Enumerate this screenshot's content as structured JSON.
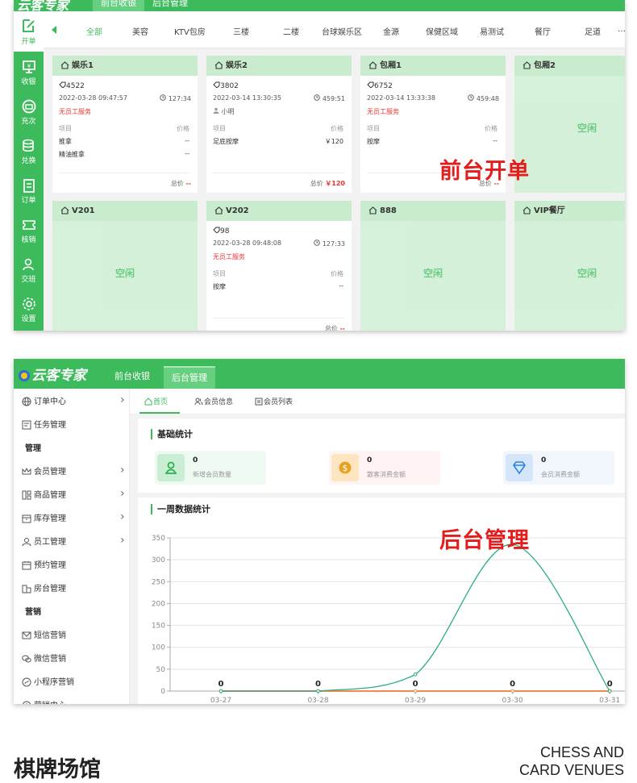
{
  "front": {
    "brand": "云客专家",
    "top_tabs": [
      "前台收银",
      "后台管理"
    ],
    "sidebar": [
      "开单",
      "收银",
      "充次",
      "兑换",
      "订单",
      "核销",
      "交班",
      "设置"
    ],
    "categories": [
      "全部",
      "美容",
      "KTV包房",
      "三楼",
      "二楼",
      "台球娱乐区",
      "金源",
      "保健区域",
      "易测试",
      "餐厅",
      "足道",
      "…"
    ],
    "col_item": "项目",
    "col_price": "价格",
    "total_label": "总价",
    "idle_label": "空闲",
    "rooms": [
      {
        "name": "娱乐1",
        "guests": "4522",
        "time": "2022-03-28 09:47:57",
        "duration": "127:34",
        "staff": "无员工服务",
        "items": [
          {
            "name": "推拿",
            "price": "--"
          },
          {
            "name": "精油推拿",
            "price": "--"
          }
        ],
        "total": "--",
        "status": "busy"
      },
      {
        "name": "娱乐2",
        "guests": "3802",
        "time": "2022-03-14 13:30:35",
        "duration": "459:51",
        "staff": "小明",
        "items": [
          {
            "name": "足底按摩",
            "price": "￥120"
          }
        ],
        "total": "￥120",
        "status": "busy"
      },
      {
        "name": "包厢1",
        "guests": "6752",
        "time": "2022-03-14 13:33:38",
        "duration": "459:48",
        "staff": "无员工服务",
        "items": [
          {
            "name": "按摩",
            "price": "--"
          }
        ],
        "total": "--",
        "status": "busy"
      },
      {
        "name": "包厢2",
        "status": "idle"
      },
      {
        "name": "V201",
        "status": "idle"
      },
      {
        "name": "V202",
        "guests": "98",
        "time": "2022-03-28 09:48:08",
        "duration": "127:33",
        "staff": "无员工服务",
        "items": [
          {
            "name": "按摩",
            "price": "--"
          }
        ],
        "total": "--",
        "status": "busy"
      },
      {
        "name": "888",
        "status": "idle"
      },
      {
        "name": "VIP餐厅",
        "status": "idle"
      }
    ],
    "overlay": "前台开单"
  },
  "back": {
    "brand": "云客专家",
    "top_tabs": [
      "前台收银",
      "后台管理"
    ],
    "menu": [
      {
        "label": "订单中心",
        "chevron": true,
        "icon": "globe-icon"
      },
      {
        "label": "任务管理",
        "chevron": false,
        "icon": "task-icon"
      },
      {
        "label": "管理",
        "group": true
      },
      {
        "label": "会员管理",
        "chevron": true,
        "icon": "crown-icon"
      },
      {
        "label": "商品管理",
        "chevron": true,
        "icon": "goods-icon"
      },
      {
        "label": "库存管理",
        "chevron": true,
        "icon": "inventory-icon"
      },
      {
        "label": "员工管理",
        "chevron": true,
        "icon": "user-icon"
      },
      {
        "label": "预约管理",
        "chevron": false,
        "icon": "calendar-icon"
      },
      {
        "label": "房台管理",
        "chevron": false,
        "icon": "building-icon"
      },
      {
        "label": "营销",
        "group": true
      },
      {
        "label": "短信营销",
        "chevron": false,
        "icon": "mail-icon"
      },
      {
        "label": "微信营销",
        "chevron": false,
        "icon": "wechat-icon"
      },
      {
        "label": "小程序营销",
        "chevron": false,
        "icon": "miniapp-icon"
      },
      {
        "label": "营销中心",
        "chevron": false,
        "icon": "target-icon"
      }
    ],
    "tabs": [
      "首页",
      "会员信息",
      "会员列表"
    ],
    "basic_title": "基础统计",
    "stats": [
      {
        "value": "0",
        "label": "新增会员数量",
        "bg": "#eefaf1",
        "icon_bg": "#c9eed4",
        "color": "#2fae55",
        "icon": "person-icon"
      },
      {
        "value": "0",
        "label": "散客消费金额",
        "bg": "#fff3f4",
        "icon_bg": "#fde6bf",
        "color": "#e7a21f",
        "icon": "coin-icon"
      },
      {
        "value": "0",
        "label": "会员消费金额",
        "bg": "#f1f6fd",
        "icon_bg": "#d6e6fa",
        "color": "#2b84e0",
        "icon": "diamond-icon"
      }
    ],
    "week_title": "一周数据统计",
    "overlay": "后台管理"
  },
  "chart_data": {
    "type": "line",
    "categories": [
      "03-27",
      "03-28",
      "03-29",
      "03-30",
      "03-31"
    ],
    "series": [
      {
        "values": [
          0,
          0,
          38,
          335,
          0
        ],
        "color": "#2bab86"
      },
      {
        "values": [
          0,
          0,
          0,
          0,
          0
        ],
        "color": "#f08a4b"
      }
    ],
    "data_labels": [
      "0",
      "0",
      "0",
      "0",
      "0"
    ],
    "ylim": [
      0,
      350
    ],
    "yticks": [
      0,
      50,
      100,
      150,
      200,
      250,
      300,
      350
    ],
    "grid": true
  },
  "footer": {
    "title_cn": "棋牌场馆",
    "title_en_1": "CHESS AND",
    "title_en_2": "CARD VENUES"
  }
}
